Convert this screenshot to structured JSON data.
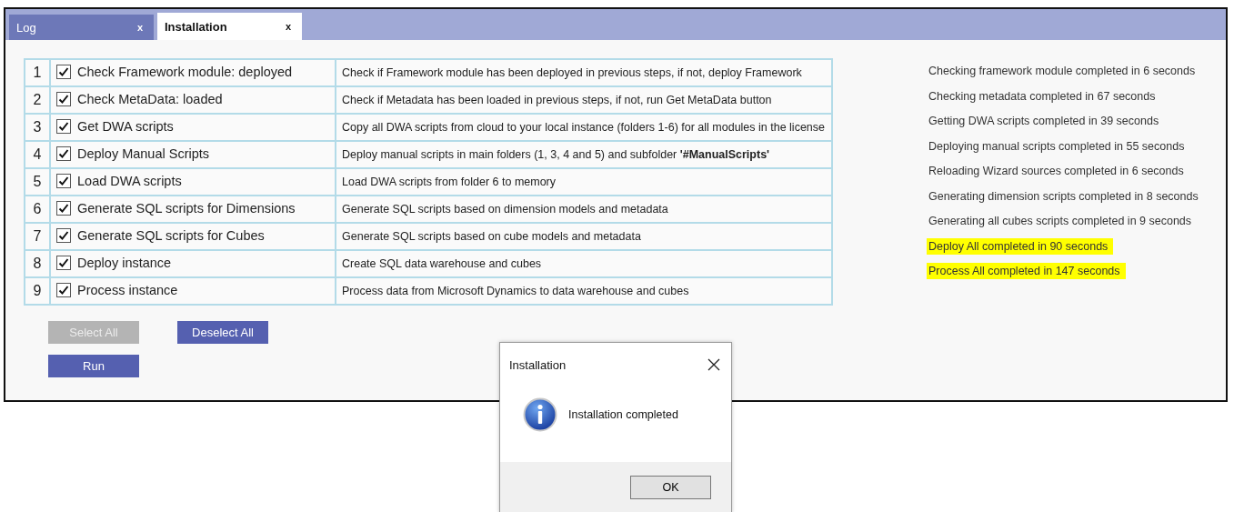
{
  "tabs": [
    {
      "label": "Log",
      "close": "x",
      "selected": false
    },
    {
      "label": "Installation",
      "close": "x",
      "selected": true
    }
  ],
  "steps": [
    {
      "number": "1",
      "label": "Check Framework module: deployed",
      "checked": true,
      "description": "Check if Framework module has been deployed in previous steps, if not, deploy Framework"
    },
    {
      "number": "2",
      "label": "Check MetaData: loaded",
      "checked": true,
      "description": "Check if Metadata has been loaded in previous steps, if not, run Get MetaData button"
    },
    {
      "number": "3",
      "label": "Get DWA scripts",
      "checked": true,
      "description": "Copy all DWA scripts from cloud to your local instance (folders 1-6) for all modules in the license"
    },
    {
      "number": "4",
      "label": "Deploy Manual Scripts",
      "checked": true,
      "description": "Deploy manual scripts in main folders (1, 3, 4 and 5) and subfolder **'#ManualScripts'**"
    },
    {
      "number": "5",
      "label": "Load DWA scripts",
      "checked": true,
      "description": "Load DWA scripts from folder 6 to memory"
    },
    {
      "number": "6",
      "label": "Generate SQL scripts for Dimensions",
      "checked": true,
      "description": "Generate SQL scripts based on dimension models and metadata"
    },
    {
      "number": "7",
      "label": "Generate SQL scripts for Cubes",
      "checked": true,
      "description": "Generate SQL scripts based on cube models and metadata"
    },
    {
      "number": "8",
      "label": "Deploy instance",
      "checked": true,
      "description": "Create SQL data warehouse and cubes"
    },
    {
      "number": "9",
      "label": "Process instance",
      "checked": true,
      "description": "Process data from Microsoft Dynamics to data warehouse and cubes"
    }
  ],
  "buttons": [
    {
      "label": "Select All",
      "disabled": true
    },
    {
      "label": "Deselect All",
      "disabled": false
    },
    {
      "label": "Run",
      "disabled": false
    }
  ],
  "log": [
    {
      "text": "Checking framework module completed in 6 seconds",
      "highlighted": false
    },
    {
      "text": "Checking metadata completed in 67 seconds",
      "highlighted": false
    },
    {
      "text": "Getting DWA scripts completed in 39 seconds",
      "highlighted": false
    },
    {
      "text": "Deploying manual scripts completed in 55 seconds",
      "highlighted": false
    },
    {
      "text": "Reloading Wizard sources completed in 6 seconds",
      "highlighted": false
    },
    {
      "text": "Generating dimension scripts completed in 8 seconds",
      "highlighted": false
    },
    {
      "text": "Generating all cubes scripts completed in 9 seconds",
      "highlighted": false
    },
    {
      "text": "Deploy All completed in 90 seconds",
      "highlighted": true
    },
    {
      "text": "Process All completed in 147 seconds",
      "highlighted": true
    }
  ],
  "dialog": {
    "title": "Installation",
    "message": "Installation completed",
    "button": "OK"
  }
}
